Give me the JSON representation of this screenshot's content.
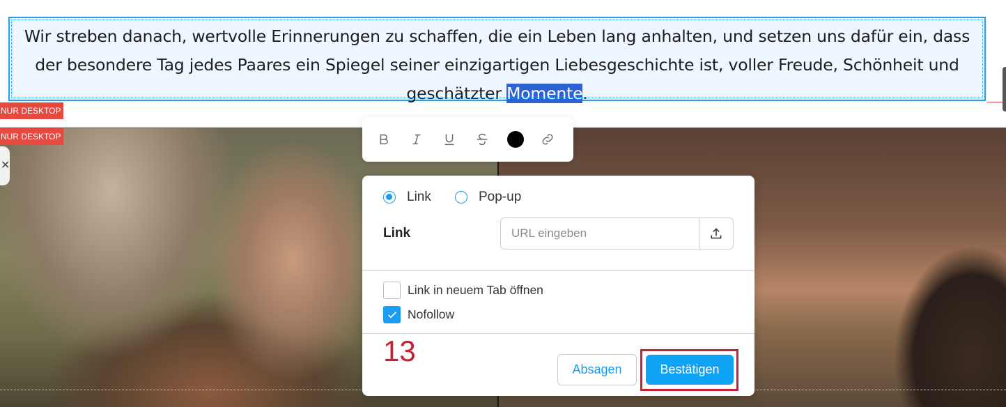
{
  "content": {
    "paragraph_before": "Wir streben danach, wertvolle Erinnerungen zu schaffen, die ein Leben lang anhalten, und setzen uns dafür ein, dass der besondere Tag jedes Paares ein Spiegel seiner einzigartigen Liebesgeschichte ist, voller Freude, Schönheit und geschätzter ",
    "paragraph_selected": "Momente",
    "paragraph_after": "."
  },
  "badges": {
    "first": "NUR DESKTOP",
    "second": "NUR DESKTOP"
  },
  "toolbar": {
    "icons": [
      "bold-icon",
      "italic-icon",
      "underline-icon",
      "strikethrough-icon",
      "text-color",
      "link-icon"
    ],
    "text_color": "#000000"
  },
  "link_dialog": {
    "radio_link_label": "Link",
    "radio_popup_label": "Pop-up",
    "selected_type": "Link",
    "link_field_label": "Link",
    "url_placeholder": "URL eingeben",
    "url_value": "",
    "new_tab_label": "Link in neuem Tab öffnen",
    "new_tab_checked": false,
    "nofollow_label": "Nofollow",
    "nofollow_checked": true,
    "step_number": "13",
    "cancel_label": "Absagen",
    "confirm_label": "Bestätigen"
  },
  "colors": {
    "accent": "#1a9df0",
    "confirm_button": "#0ea3f5",
    "annotation": "#c8202e",
    "badge": "#e5493f",
    "selection": "#2e62d4"
  }
}
